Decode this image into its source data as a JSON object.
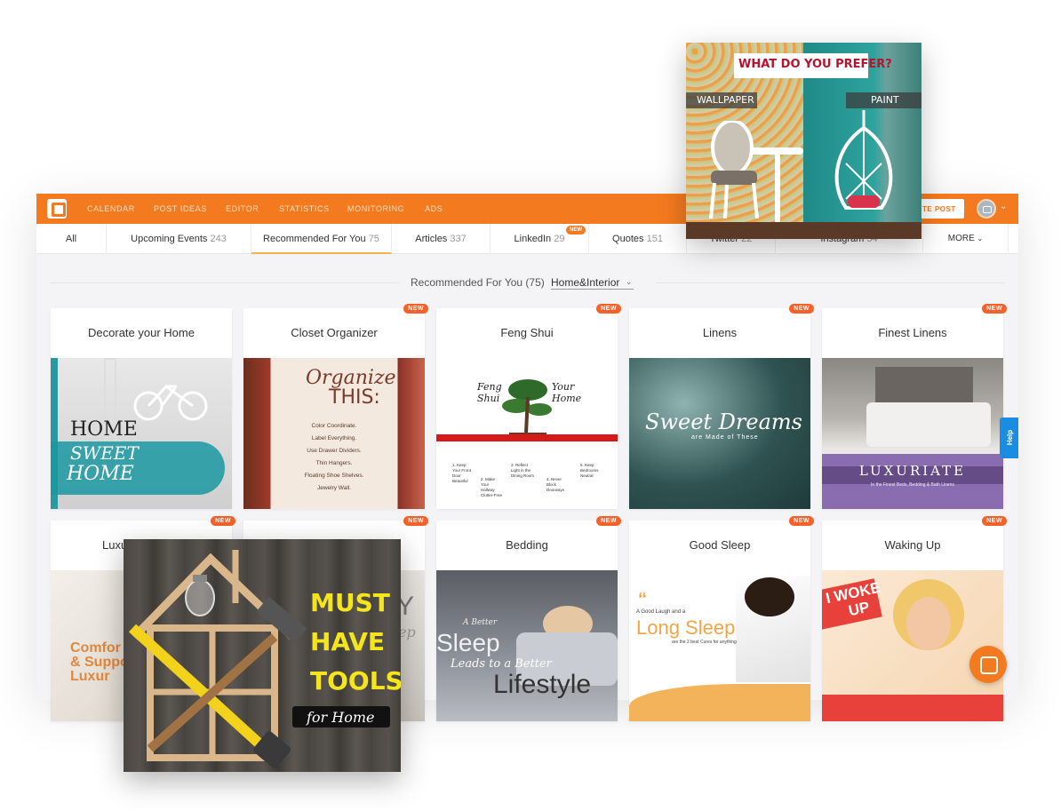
{
  "topbar": {
    "nav": [
      "CALENDAR",
      "POST IDEAS",
      "EDITOR",
      "STATISTICS",
      "MONITORING",
      "ADS"
    ],
    "create_label": "TE POST",
    "colors": {
      "accent": "#f47a1f",
      "badge": "#f4622a",
      "help": "#1a8de0"
    }
  },
  "tabs": [
    {
      "label": "All",
      "count": ""
    },
    {
      "label": "Upcoming Events",
      "count": "243"
    },
    {
      "label": "Recommended For You",
      "count": "75"
    },
    {
      "label": "Articles",
      "count": "337"
    },
    {
      "label": "LinkedIn",
      "count": "29",
      "badge": "NEW"
    },
    {
      "label": "Quotes",
      "count": "151"
    },
    {
      "label": "Twitter",
      "count": "22"
    },
    {
      "label": "Instagram",
      "count": "54"
    }
  ],
  "more_label": "MORE",
  "filter": {
    "label": "Recommended For You (75)",
    "value": "Home&Interior"
  },
  "badge_label": "NEW",
  "cards": [
    {
      "title": "Decorate your Home",
      "is_new": false,
      "text1": "HOME",
      "text2": "SWEET",
      "text3": "HOME"
    },
    {
      "title": "Closet Organizer",
      "is_new": true,
      "text1": "Organize",
      "text2": "THIS:",
      "lines": [
        "Color Coordinate.",
        "Label Everything.",
        "Use Drawer Dividers.",
        "Thin Hangers.",
        "Floating Shoe Shelves.",
        "Jewelry Wall."
      ]
    },
    {
      "title": "Feng Shui",
      "is_new": true,
      "text1": "Feng Shui",
      "text2": "Your Home",
      "lines": [
        "1. Keep Your Front Door Beautiful",
        "2. Make Your Hallway Clutter-Free",
        "3. Reflect Light in the Dining Room",
        "4. Never Block Doorways",
        "5. Keep Bedrooms Neutral"
      ]
    },
    {
      "title": "Linens",
      "is_new": true,
      "text1": "Sweet Dreams",
      "text2": "are Made of These"
    },
    {
      "title": "Finest Linens",
      "is_new": true,
      "text1": "LUXURIATE",
      "text2": "In the Finest Beds, Bedding & Bath Linens"
    },
    {
      "title": "Luxu",
      "is_new": true,
      "text1": "Comfor",
      "text2": "& Suppo",
      "text3": "Luxur"
    },
    {
      "title": "",
      "is_new": true,
      "text1": "Y",
      "text2": "ep"
    },
    {
      "title": "Bedding",
      "is_new": true,
      "text1": "A Better",
      "text2": "Sleep",
      "text3": "Leads to a Better",
      "text4": "Lifestyle"
    },
    {
      "title": "Good Sleep",
      "is_new": true,
      "text1": "A Good Laugh and a",
      "text2": "Long Sleep",
      "text3": "are the 2 best Cures for anything"
    },
    {
      "title": "Waking Up",
      "is_new": true,
      "text1": "I WOKE",
      "text2": "UP"
    }
  ],
  "help_label": "Help",
  "float_top": {
    "question": "WHAT DO YOU PREFER?",
    "left": "WALLPAPER",
    "right": "PAINT"
  },
  "float_bottom": {
    "line1": "MUST",
    "line2": "HAVE",
    "line3": "TOOLS",
    "sub": "for Home"
  }
}
